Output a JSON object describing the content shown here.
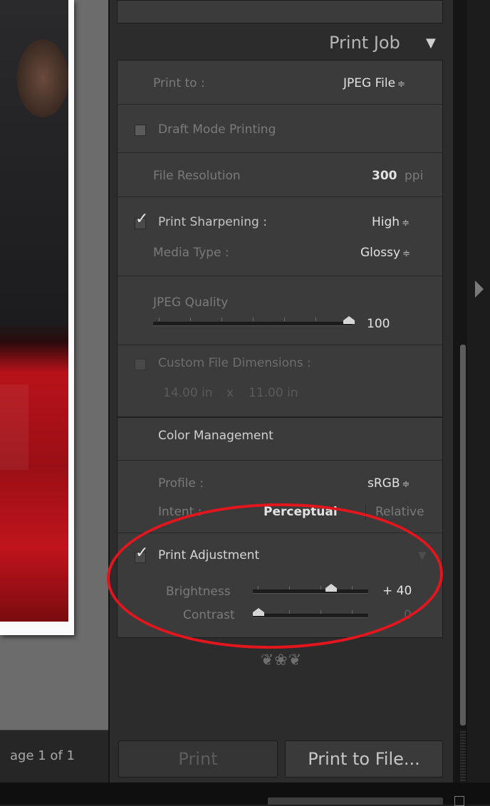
{
  "preview": {
    "page_info": "age 1 of 1"
  },
  "print_job": {
    "header": "Print Job",
    "print_to": {
      "label": "Print to :",
      "value": "JPEG File"
    },
    "draft_mode": {
      "label": "Draft Mode Printing",
      "checked": false
    },
    "file_resolution": {
      "label": "File Resolution",
      "value": "300",
      "unit": "ppi"
    },
    "print_sharpening": {
      "label": "Print Sharpening :",
      "value": "High",
      "checked": true
    },
    "media_type": {
      "label": "Media Type :",
      "value": "Glossy"
    },
    "jpeg_quality": {
      "label": "JPEG Quality",
      "value": "100",
      "level": 1.0
    },
    "custom_dimensions": {
      "label": "Custom File Dimensions :",
      "checked": false,
      "width": "14.00 in",
      "x": "x",
      "height": "11.00 in"
    }
  },
  "color_management": {
    "header": "Color Management",
    "profile": {
      "label": "Profile :",
      "value": "sRGB"
    },
    "intent": {
      "label": "Intent :",
      "option_perceptual": "Perceptual",
      "option_relative": "Relative"
    }
  },
  "print_adjustment": {
    "label": "Print Adjustment",
    "checked": true,
    "brightness": {
      "label": "Brightness",
      "value": "+ 40",
      "level": 0.7
    },
    "contrast": {
      "label": "Contrast",
      "value": "0",
      "level": 0.0
    }
  },
  "buttons": {
    "print": "Print",
    "print_to_file": "Print to File..."
  },
  "icons": {
    "collapse": "triangle-down-icon",
    "stepper": "up-down-arrows-icon",
    "check": "checkmark-icon",
    "panel_toggle": "triangle-right-icon",
    "flourish": "panel-end-flourish-icon"
  },
  "colors": {
    "panel": "#3b3b3b",
    "highlight": "#e2161c",
    "text_bright": "#e2e2e2"
  }
}
